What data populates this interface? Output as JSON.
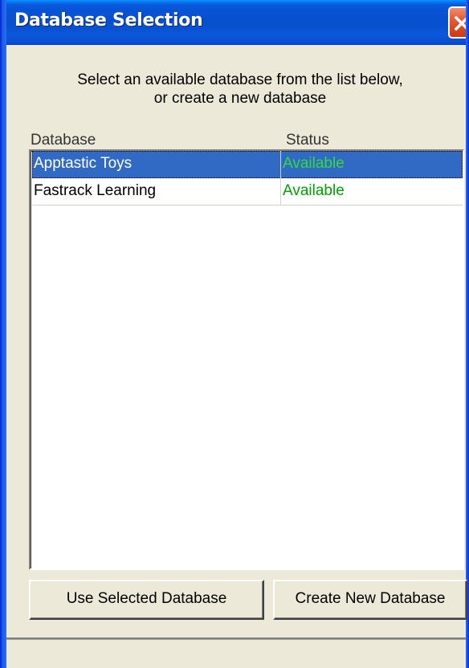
{
  "window": {
    "title": "Database Selection"
  },
  "instructions": {
    "line1": "Select an available database from the list below,",
    "line2": "or create a new database"
  },
  "list": {
    "columns": {
      "database": "Database",
      "status": "Status"
    },
    "rows": [
      {
        "database": "Apptastic Toys",
        "status": "Available",
        "selected": true
      },
      {
        "database": "Fastrack Learning",
        "status": "Available",
        "selected": false
      }
    ]
  },
  "buttons": {
    "use_selected": "Use Selected Database",
    "create_new": "Create New Database"
  },
  "colors": {
    "titlebar": "#0a54d8",
    "selection": "#316ac5",
    "status_available": "#00a000",
    "dialog_bg": "#ece9d8",
    "close_button": "#e35a33"
  },
  "icons": {
    "close": "close-icon"
  }
}
